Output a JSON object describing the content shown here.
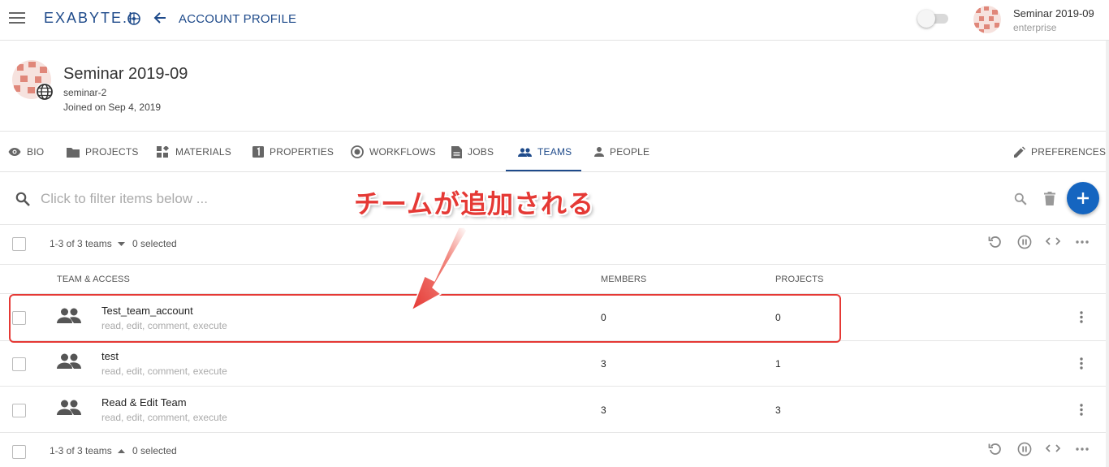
{
  "topbar": {
    "logo": "EXABYTE.I",
    "title": "ACCOUNT PROFILE",
    "user_name": "Seminar 2019-09",
    "user_sub": "enterprise"
  },
  "profile": {
    "name": "Seminar 2019-09",
    "handle": "seminar-2",
    "joined": "Joined on Sep 4, 2019"
  },
  "tabs": [
    {
      "label": "BIO",
      "icon": "eye-icon"
    },
    {
      "label": "PROJECTS",
      "icon": "folder-icon"
    },
    {
      "label": "MATERIALS",
      "icon": "materials-icon"
    },
    {
      "label": "PROPERTIES",
      "icon": "properties-icon"
    },
    {
      "label": "WORKFLOWS",
      "icon": "workflows-icon"
    },
    {
      "label": "JOBS",
      "icon": "jobs-icon"
    },
    {
      "label": "TEAMS",
      "icon": "group-icon",
      "active": true
    },
    {
      "label": "PEOPLE",
      "icon": "person-icon"
    },
    {
      "label": "PREFERENCES",
      "icon": "pencil-icon"
    }
  ],
  "search": {
    "placeholder": "Click to filter items below ..."
  },
  "toolbar_top": {
    "count": "1-3 of 3 teams",
    "selected": "0 selected"
  },
  "toolbar_bottom": {
    "count": "1-3 of 3 teams",
    "selected": "0 selected"
  },
  "table": {
    "headers": [
      "TEAM & ACCESS",
      "MEMBERS",
      "PROJECTS"
    ],
    "rows": [
      {
        "name": "Test_team_account",
        "access": "read, edit, comment, execute",
        "members": "0",
        "projects": "0"
      },
      {
        "name": "test",
        "access": "read, edit, comment, execute",
        "members": "3",
        "projects": "1"
      },
      {
        "name": "Read & Edit Team",
        "access": "read, edit, comment, execute",
        "members": "3",
        "projects": "3"
      }
    ]
  },
  "annotation": {
    "text": "チームが追加される"
  },
  "colors": {
    "brand": "#1e4a8a",
    "fab": "#1565c0",
    "annotation": "#e53935"
  }
}
